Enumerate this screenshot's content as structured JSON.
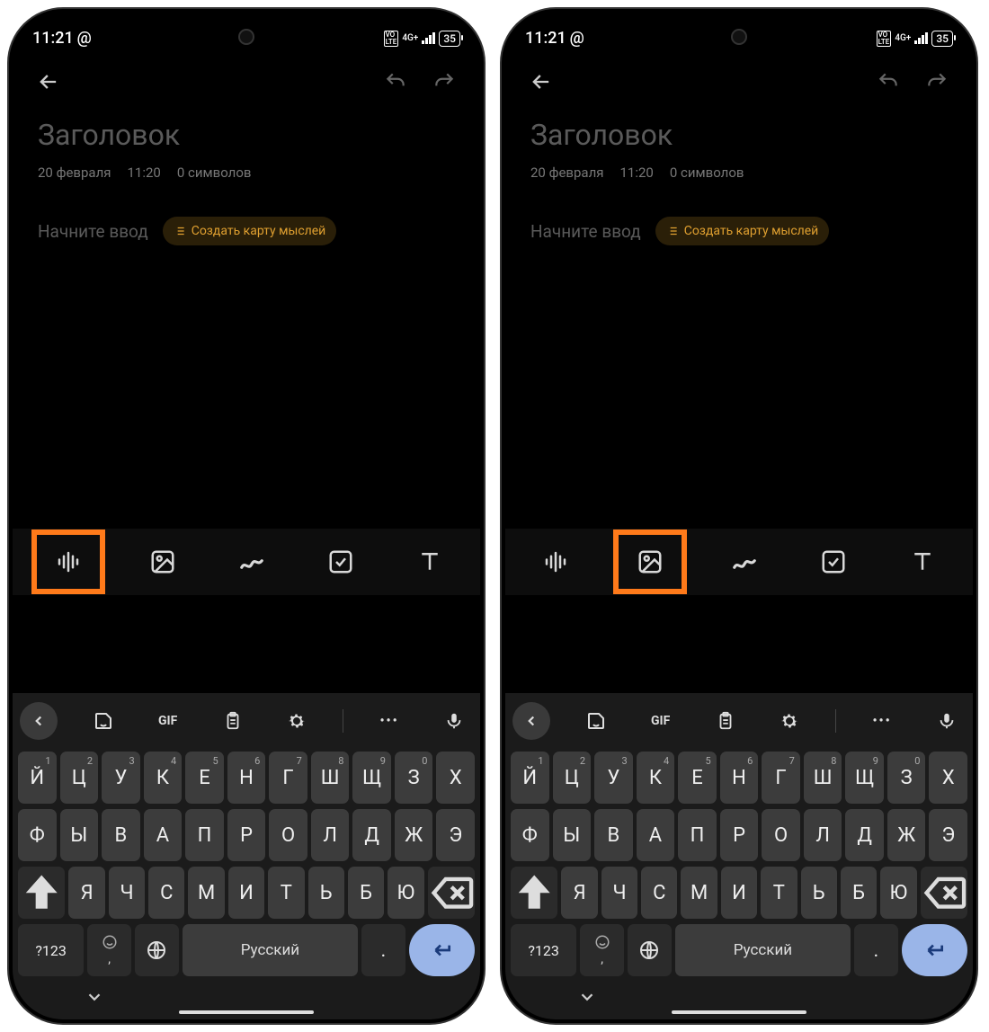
{
  "status": {
    "time": "11:21",
    "at": "@",
    "net": "4G+",
    "battery": "35"
  },
  "note": {
    "title": "Заголовок",
    "date": "20 февраля",
    "time": "11:20",
    "chars": "0 символов",
    "placeholder": "Начните ввод",
    "chip": "Создать карту мыслей"
  },
  "tools": [
    "voice-icon",
    "image-icon",
    "draw-icon",
    "checklist-icon",
    "text-icon"
  ],
  "kb": {
    "gif": "GIF",
    "row1": [
      [
        "Й",
        "1"
      ],
      [
        "Ц",
        "2"
      ],
      [
        "У",
        "3"
      ],
      [
        "К",
        "4"
      ],
      [
        "Е",
        "5"
      ],
      [
        "Н",
        "6"
      ],
      [
        "Г",
        "7"
      ],
      [
        "Ш",
        "8"
      ],
      [
        "Щ",
        "9"
      ],
      [
        "З",
        "0"
      ],
      [
        "Х",
        ""
      ]
    ],
    "row2": [
      "Ф",
      "Ы",
      "В",
      "А",
      "П",
      "Р",
      "О",
      "Л",
      "Д",
      "Ж",
      "Э"
    ],
    "row3": [
      "Я",
      "Ч",
      "С",
      "М",
      "И",
      "Т",
      "Ь",
      "Б",
      "Ю"
    ],
    "numkey": "?123",
    "space": "Русский",
    "period": "."
  },
  "highlight": [
    0,
    1
  ]
}
